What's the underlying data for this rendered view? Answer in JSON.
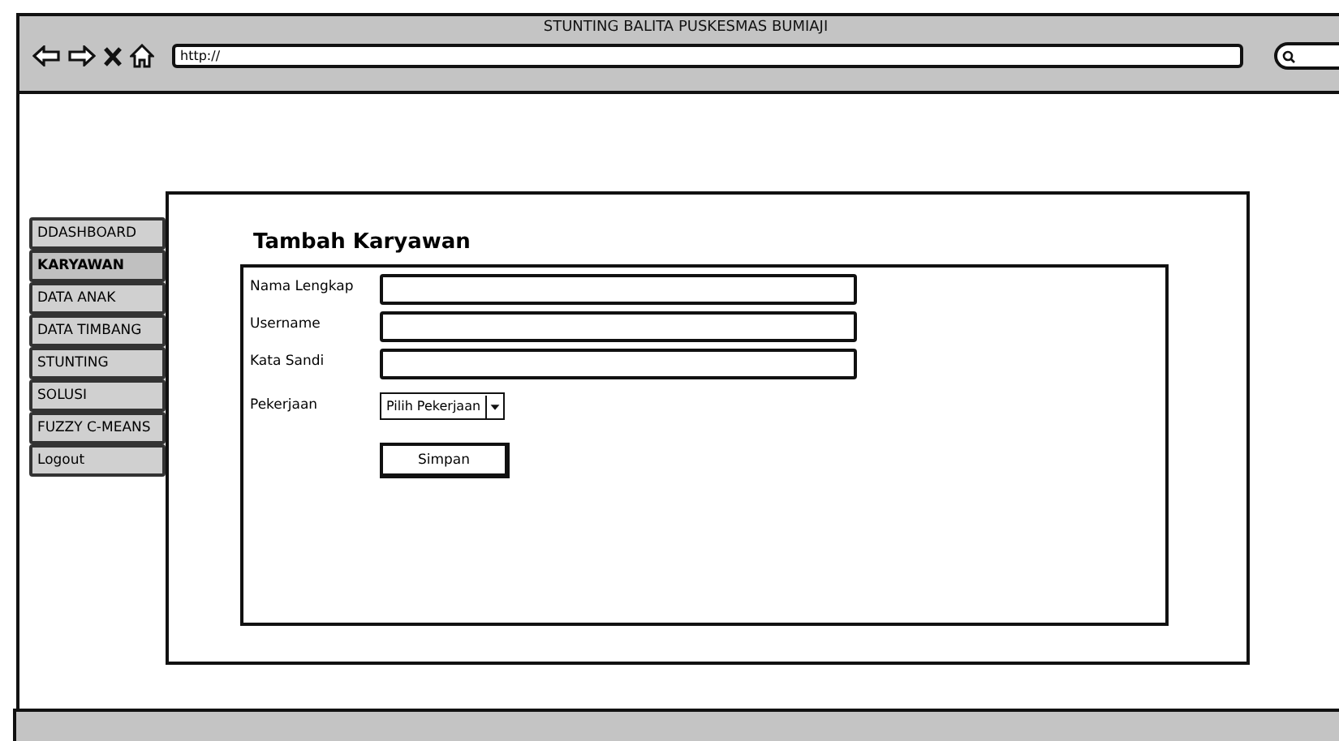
{
  "window": {
    "title": "STUNTING BALITA PUSKESMAS BUMIAJI"
  },
  "address_bar": {
    "value": "http://"
  },
  "sidebar": {
    "items": [
      {
        "label": "DDASHBOARD",
        "selected": false
      },
      {
        "label": "KARYAWAN",
        "selected": true
      },
      {
        "label": "DATA ANAK",
        "selected": false
      },
      {
        "label": "DATA TIMBANG",
        "selected": false
      },
      {
        "label": "STUNTING",
        "selected": false
      },
      {
        "label": "SOLUSI",
        "selected": false
      },
      {
        "label": "FUZZY C-MEANS",
        "selected": false
      },
      {
        "label": "Logout",
        "selected": false
      }
    ]
  },
  "form": {
    "title": "Tambah Karyawan",
    "fields": [
      {
        "kind": "text",
        "label": "Nama Lengkap"
      },
      {
        "kind": "text",
        "label": "Username"
      },
      {
        "kind": "text",
        "label": "Kata Sandi"
      },
      {
        "kind": "select",
        "label": "Pekerjaan",
        "value": "Pilih Pekerjaan"
      }
    ],
    "submit": "Simpan"
  }
}
